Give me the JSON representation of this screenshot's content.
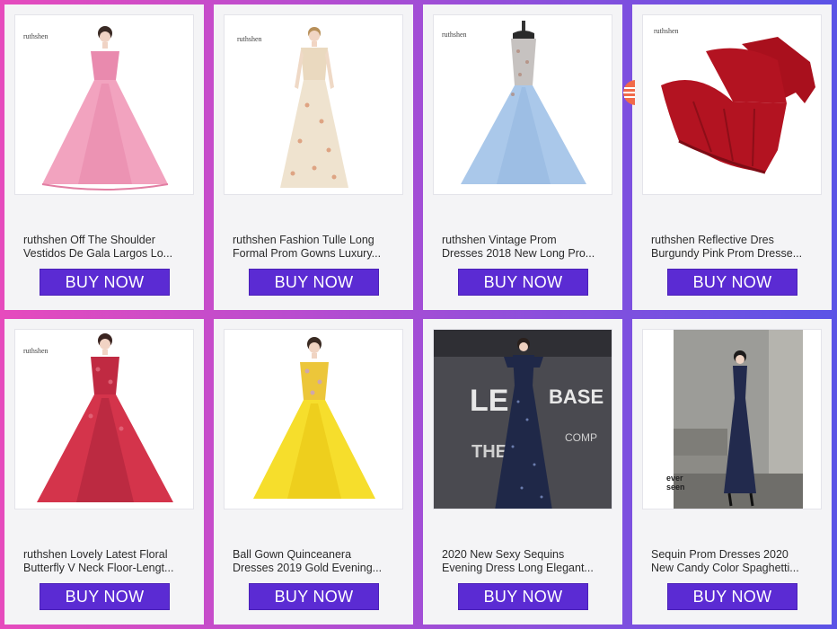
{
  "products": [
    {
      "brand": "ruthshen",
      "title_line1": "ruthshen Off The Shoulder",
      "title_line2": "Vestidos De Gala Largos Lo...",
      "button": "BUY NOW",
      "dress_color": "#f2a3bf",
      "dress_shade": "#e889ac"
    },
    {
      "brand": "ruthshen",
      "title_line1": "ruthshen Fashion Tulle Long",
      "title_line2": "Formal Prom Gowns Luxury...",
      "button": "BUY NOW",
      "dress_color": "#efe3cf",
      "dress_shade": "#d9c6a7"
    },
    {
      "brand": "ruthshen",
      "title_line1": "ruthshen Vintage Prom",
      "title_line2": "Dresses 2018 New Long Pro...",
      "button": "BUY NOW",
      "dress_color": "#aac8ea",
      "dress_shade": "#8fb3de"
    },
    {
      "brand": "ruthshen",
      "title_line1": "ruthshen Reflective Dres",
      "title_line2": "Burgundy Pink Prom Dresse...",
      "button": "BUY NOW",
      "dress_color": "#b31321",
      "dress_shade": "#7d0c15"
    },
    {
      "brand": "ruthshen",
      "title_line1": "ruthshen Lovely Latest Floral",
      "title_line2": "Butterfly V Neck Floor-Lengt...",
      "button": "BUY NOW",
      "dress_color": "#d4344b",
      "dress_shade": "#a8223a"
    },
    {
      "brand": "",
      "title_line1": "Ball Gown Quinceanera",
      "title_line2": "Dresses 2019 Gold Evening...",
      "button": "BUY NOW",
      "dress_color": "#f6de2c",
      "dress_shade": "#e7c312"
    },
    {
      "brand": "",
      "title_line1": "2020 New Sexy Sequins",
      "title_line2": "Evening Dress Long Elegant...",
      "button": "BUY NOW",
      "dress_color": "#1f2848",
      "dress_shade": "#141a33",
      "backdrop_text_1": "LE",
      "backdrop_text_2": "BASE",
      "backdrop_text_3": "THE",
      "backdrop_text_4": "COMP"
    },
    {
      "brand": "",
      "title_line1": "Sequin Prom Dresses 2020",
      "title_line2": "New Candy Color Spaghetti...",
      "button": "BUY NOW",
      "dress_color": "#222a4d",
      "dress_shade": "#161b36",
      "logo_line1": "ever",
      "logo_line2": "seen"
    }
  ]
}
